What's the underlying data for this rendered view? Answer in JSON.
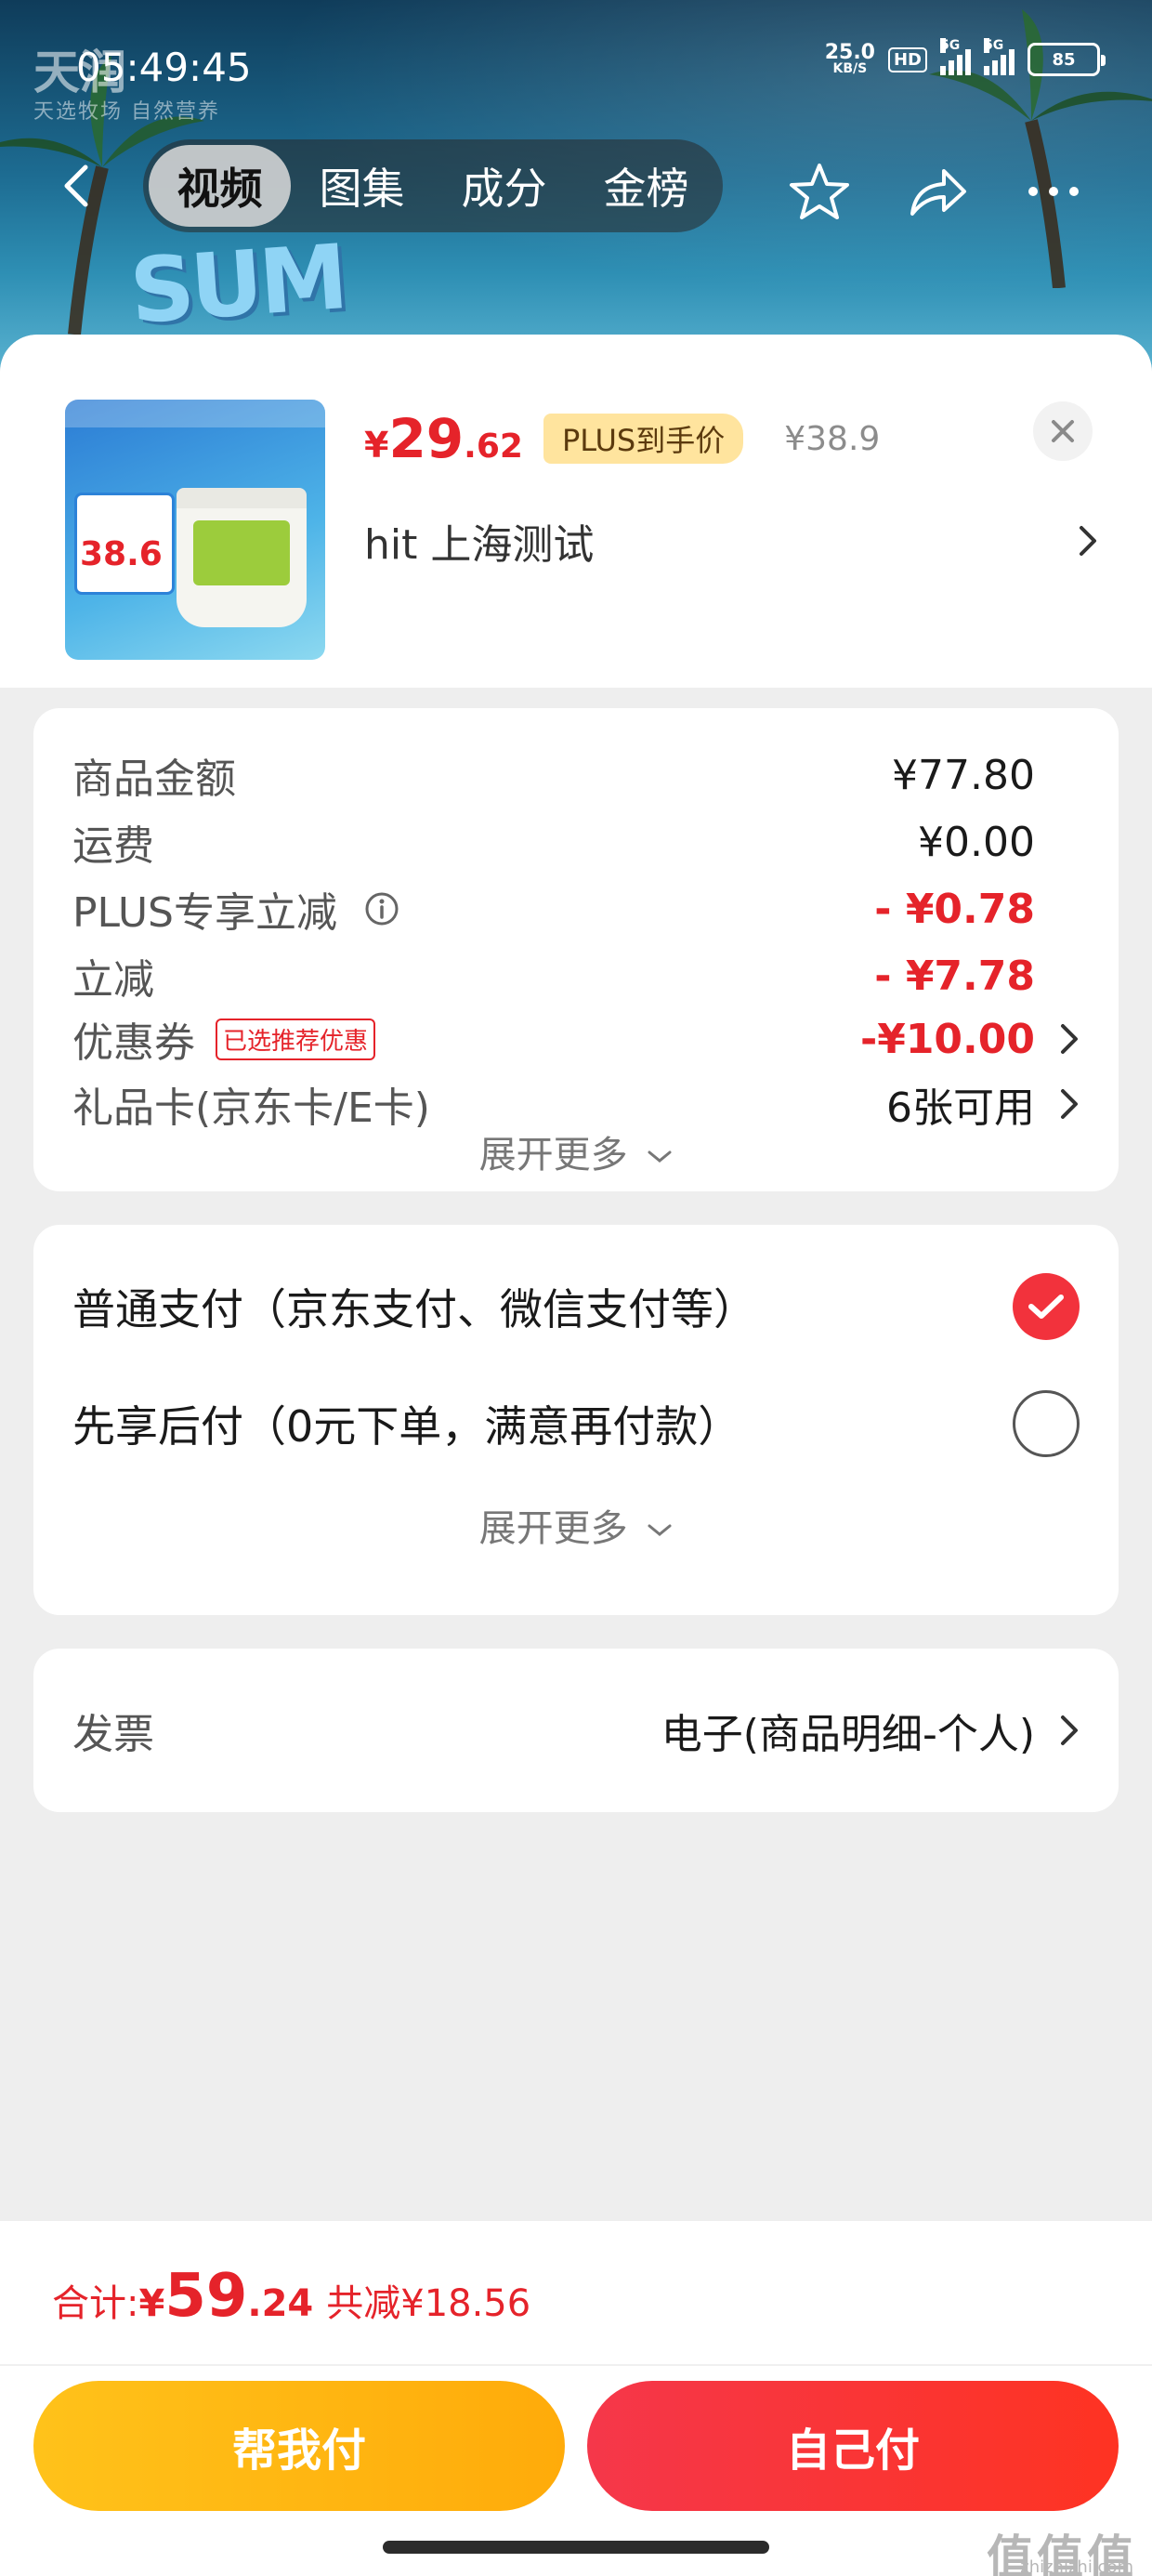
{
  "status_bar": {
    "time": "05:49:45",
    "net_speed": "25.0",
    "net_unit": "KB/S",
    "hd": "HD",
    "sig1": "5G",
    "sig2": "5G",
    "battery": "85"
  },
  "background": {
    "brand_logo": "天润",
    "brand_sub": "天选牧场 自然营养",
    "decor_text": "SUM"
  },
  "nav": {
    "tabs": [
      {
        "label": "视频",
        "active": true
      },
      {
        "label": "图集",
        "active": false
      },
      {
        "label": "成分",
        "active": false
      },
      {
        "label": "金榜",
        "active": false
      }
    ]
  },
  "product": {
    "price_symbol": "¥",
    "price_int": "29",
    "price_dec": ".62",
    "plus_badge": "PLUS到手价",
    "original_price": "¥38.9",
    "address": "hit  上海测试",
    "thumb_price": "38.6"
  },
  "amounts": {
    "rows": [
      {
        "label": "商品金额",
        "value": "¥77.80"
      },
      {
        "label": "运费",
        "value": "¥0.00"
      },
      {
        "label": "PLUS专享立减",
        "value": "- ¥0.78"
      },
      {
        "label": "立减",
        "value": "- ¥7.78"
      },
      {
        "label": "优惠券",
        "tag": "已选推荐优惠",
        "value": "-¥10.00"
      },
      {
        "label": "礼品卡(京东卡/E卡)",
        "value": "6张可用"
      }
    ],
    "expand": "展开更多"
  },
  "payment": {
    "options": [
      {
        "label": "普通支付（京东支付、微信支付等）",
        "selected": true
      },
      {
        "label": "先享后付（0元下单，满意再付款）",
        "selected": false
      }
    ],
    "expand": "展开更多"
  },
  "invoice": {
    "label": "发票",
    "value": "电子(商品明细-个人)"
  },
  "footer": {
    "total_label": "合计: ",
    "total_symbol": "¥",
    "total_int": "59",
    "total_dec": ".24",
    "saved": "共减¥18.56",
    "help_pay": "帮我付",
    "self_pay": "自己付"
  },
  "watermark": {
    "text": "值值值",
    "url": "zhizhizhi.com"
  },
  "colors": {
    "accent_red": "#e5232a",
    "plus_gold": "#ffe49e",
    "help_btn": "#ffb512",
    "self_btn": "#f5374a"
  }
}
